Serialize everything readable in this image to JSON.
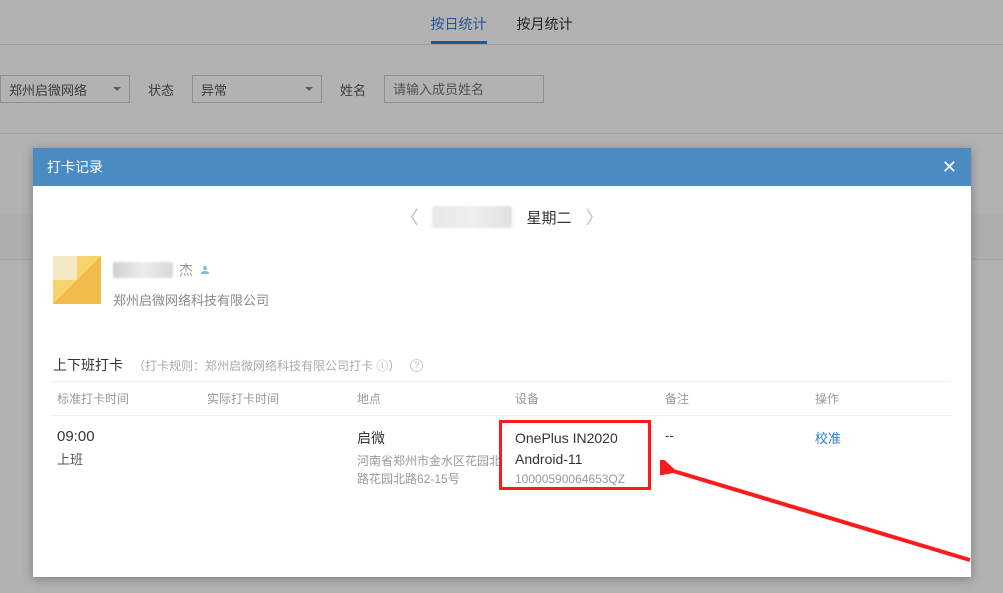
{
  "bg": {
    "tabs": {
      "daily": "按日统计",
      "monthly": "按月统计"
    },
    "filters": {
      "org_value": "郑州启微网络",
      "status_label": "状态",
      "status_value": "异常",
      "name_label": "姓名",
      "name_placeholder": "请输入成员姓名"
    }
  },
  "modal": {
    "title": "打卡记录",
    "day_label": "星期二",
    "user": {
      "name_suffix": "杰",
      "company": "郑州启微网络科技有限公司"
    },
    "section": {
      "title": "上下班打卡",
      "rule": "（打卡规则：郑州启微网络科技有限公司打卡 ⓘ）"
    },
    "columns": {
      "std": "标准打卡时间",
      "act": "实际打卡时间",
      "loc": "地点",
      "dev": "设备",
      "note": "备注",
      "op": "操作"
    },
    "rows": [
      {
        "std_time": "09:00",
        "std_sub": "上班",
        "act_time": "",
        "loc_name": "启微",
        "loc_addr": "河南省郑州市金水区花园北路花园北路62-15号",
        "dev_model": "OnePlus IN2020",
        "dev_os": "Android-11",
        "dev_id": "10000590064653QZ",
        "note": "--",
        "op": "校准"
      }
    ]
  }
}
